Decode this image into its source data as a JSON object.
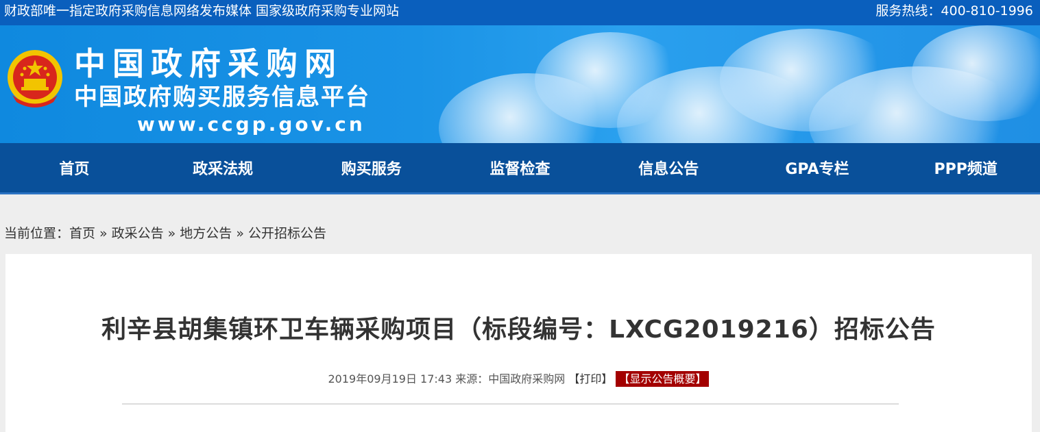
{
  "topbar": {
    "left_text": "财政部唯一指定政府采购信息网络发布媒体 国家级政府采购专业网站",
    "right_text": "服务热线：400-810-1996"
  },
  "banner": {
    "title": "中国政府采购网",
    "subtitle": "中国政府购买服务信息平台",
    "url": "www.ccgp.gov.cn"
  },
  "nav": {
    "items": [
      "首页",
      "政采法规",
      "购买服务",
      "监督检查",
      "信息公告",
      "GPA专栏",
      "PPP频道"
    ]
  },
  "breadcrumb": {
    "prefix": "当前位置：",
    "items": [
      "首页",
      "政采公告",
      "地方公告",
      "公开招标公告"
    ],
    "separator": "»"
  },
  "article": {
    "title": "利辛县胡集镇环卫车辆采购项目（标段编号：LXCG2019216）招标公告",
    "datetime": "2019年09月19日 17:43",
    "source_label": "来源：",
    "source": "中国政府采购网",
    "print_label": "【打印】",
    "summary_label": "【显示公告概要】"
  },
  "colors": {
    "topbar": "#0a5fbd",
    "nav": "#09509a",
    "summary_badge": "#a30000"
  }
}
